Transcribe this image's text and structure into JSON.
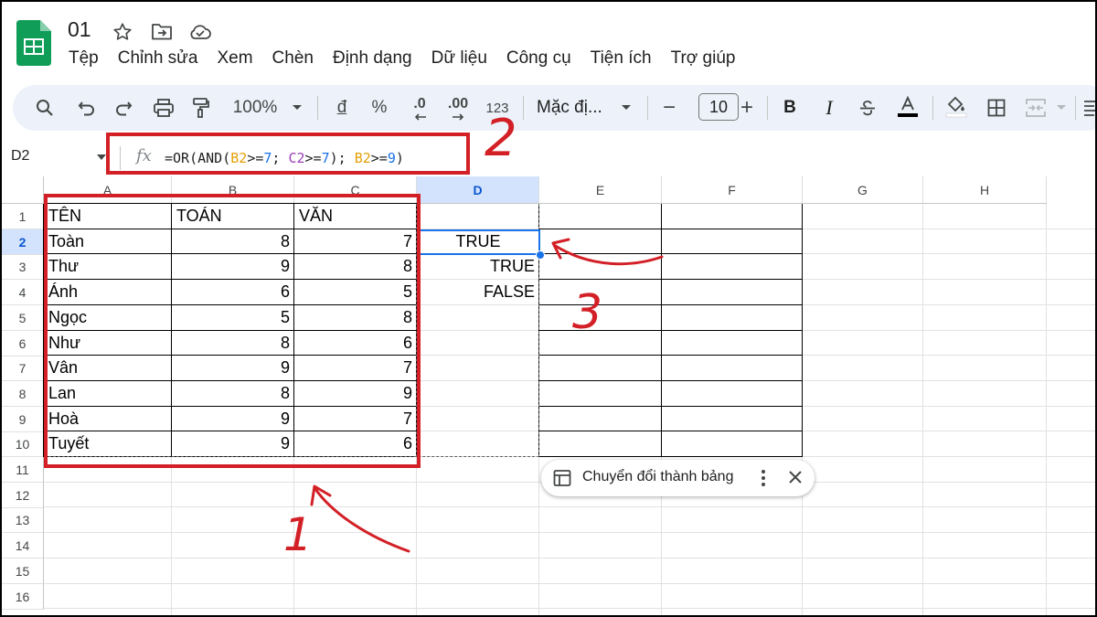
{
  "app": {
    "doc_title": "01",
    "menu": [
      "Tệp",
      "Chỉnh sửa",
      "Xem",
      "Chèn",
      "Định dạng",
      "Dữ liệu",
      "Công cụ",
      "Tiện ích",
      "Trợ giúp"
    ]
  },
  "toolbar": {
    "zoom": "100%",
    "currency": "đ",
    "percent": "%",
    "dec_decrease": ".0",
    "dec_increase": ".00",
    "number_format": "123",
    "font_name": "Mặc đị...",
    "font_size": "10",
    "minus": "−",
    "plus": "+",
    "bold": "B",
    "italic": "I"
  },
  "formula_bar": {
    "name_box": "D2",
    "fx": "fx",
    "parts": [
      "=OR(AND(",
      "B2",
      ">=",
      "7",
      "; ",
      "C2",
      ">=",
      "7",
      "); ",
      "B2",
      ">=",
      "9",
      ")"
    ]
  },
  "grid": {
    "columns": [
      "A",
      "B",
      "C",
      "D",
      "E",
      "F",
      "G",
      "H"
    ],
    "rows": [
      "1",
      "2",
      "3",
      "4",
      "5",
      "6",
      "7",
      "8",
      "9",
      "10",
      "11",
      "12",
      "13",
      "14",
      "15",
      "16"
    ],
    "selected_cell": "D2",
    "cells": {
      "A1": "TÊN",
      "B1": "TOÁN",
      "C1": "VĂN",
      "A2": "Toàn",
      "B2": "8",
      "C2": "7",
      "D2": "TRUE",
      "A3": "Thư",
      "B3": "9",
      "C3": "8",
      "D3": "TRUE",
      "A4": "Ánh",
      "B4": "6",
      "C4": "5",
      "D4": "FALSE",
      "A5": "Ngọc",
      "B5": "5",
      "C5": "8",
      "A6": "Như",
      "B6": "8",
      "C6": "6",
      "A7": "Vân",
      "B7": "9",
      "C7": "7",
      "A8": "Lan",
      "B8": "8",
      "C8": "9",
      "A9": "Hoà",
      "B9": "9",
      "C9": "7",
      "A10": "Tuyết",
      "B10": "9",
      "C10": "6"
    }
  },
  "chip": {
    "label": "Chuyển đổi thành bảng"
  },
  "annotations": {
    "label_1": "1",
    "label_2": "2",
    "label_3": "3"
  },
  "colors": {
    "selection": "#1a73e8",
    "annotation_red": "#d32027",
    "toolbar_bg": "#edf2fa",
    "header_selected_bg": "#d3e3fd"
  }
}
